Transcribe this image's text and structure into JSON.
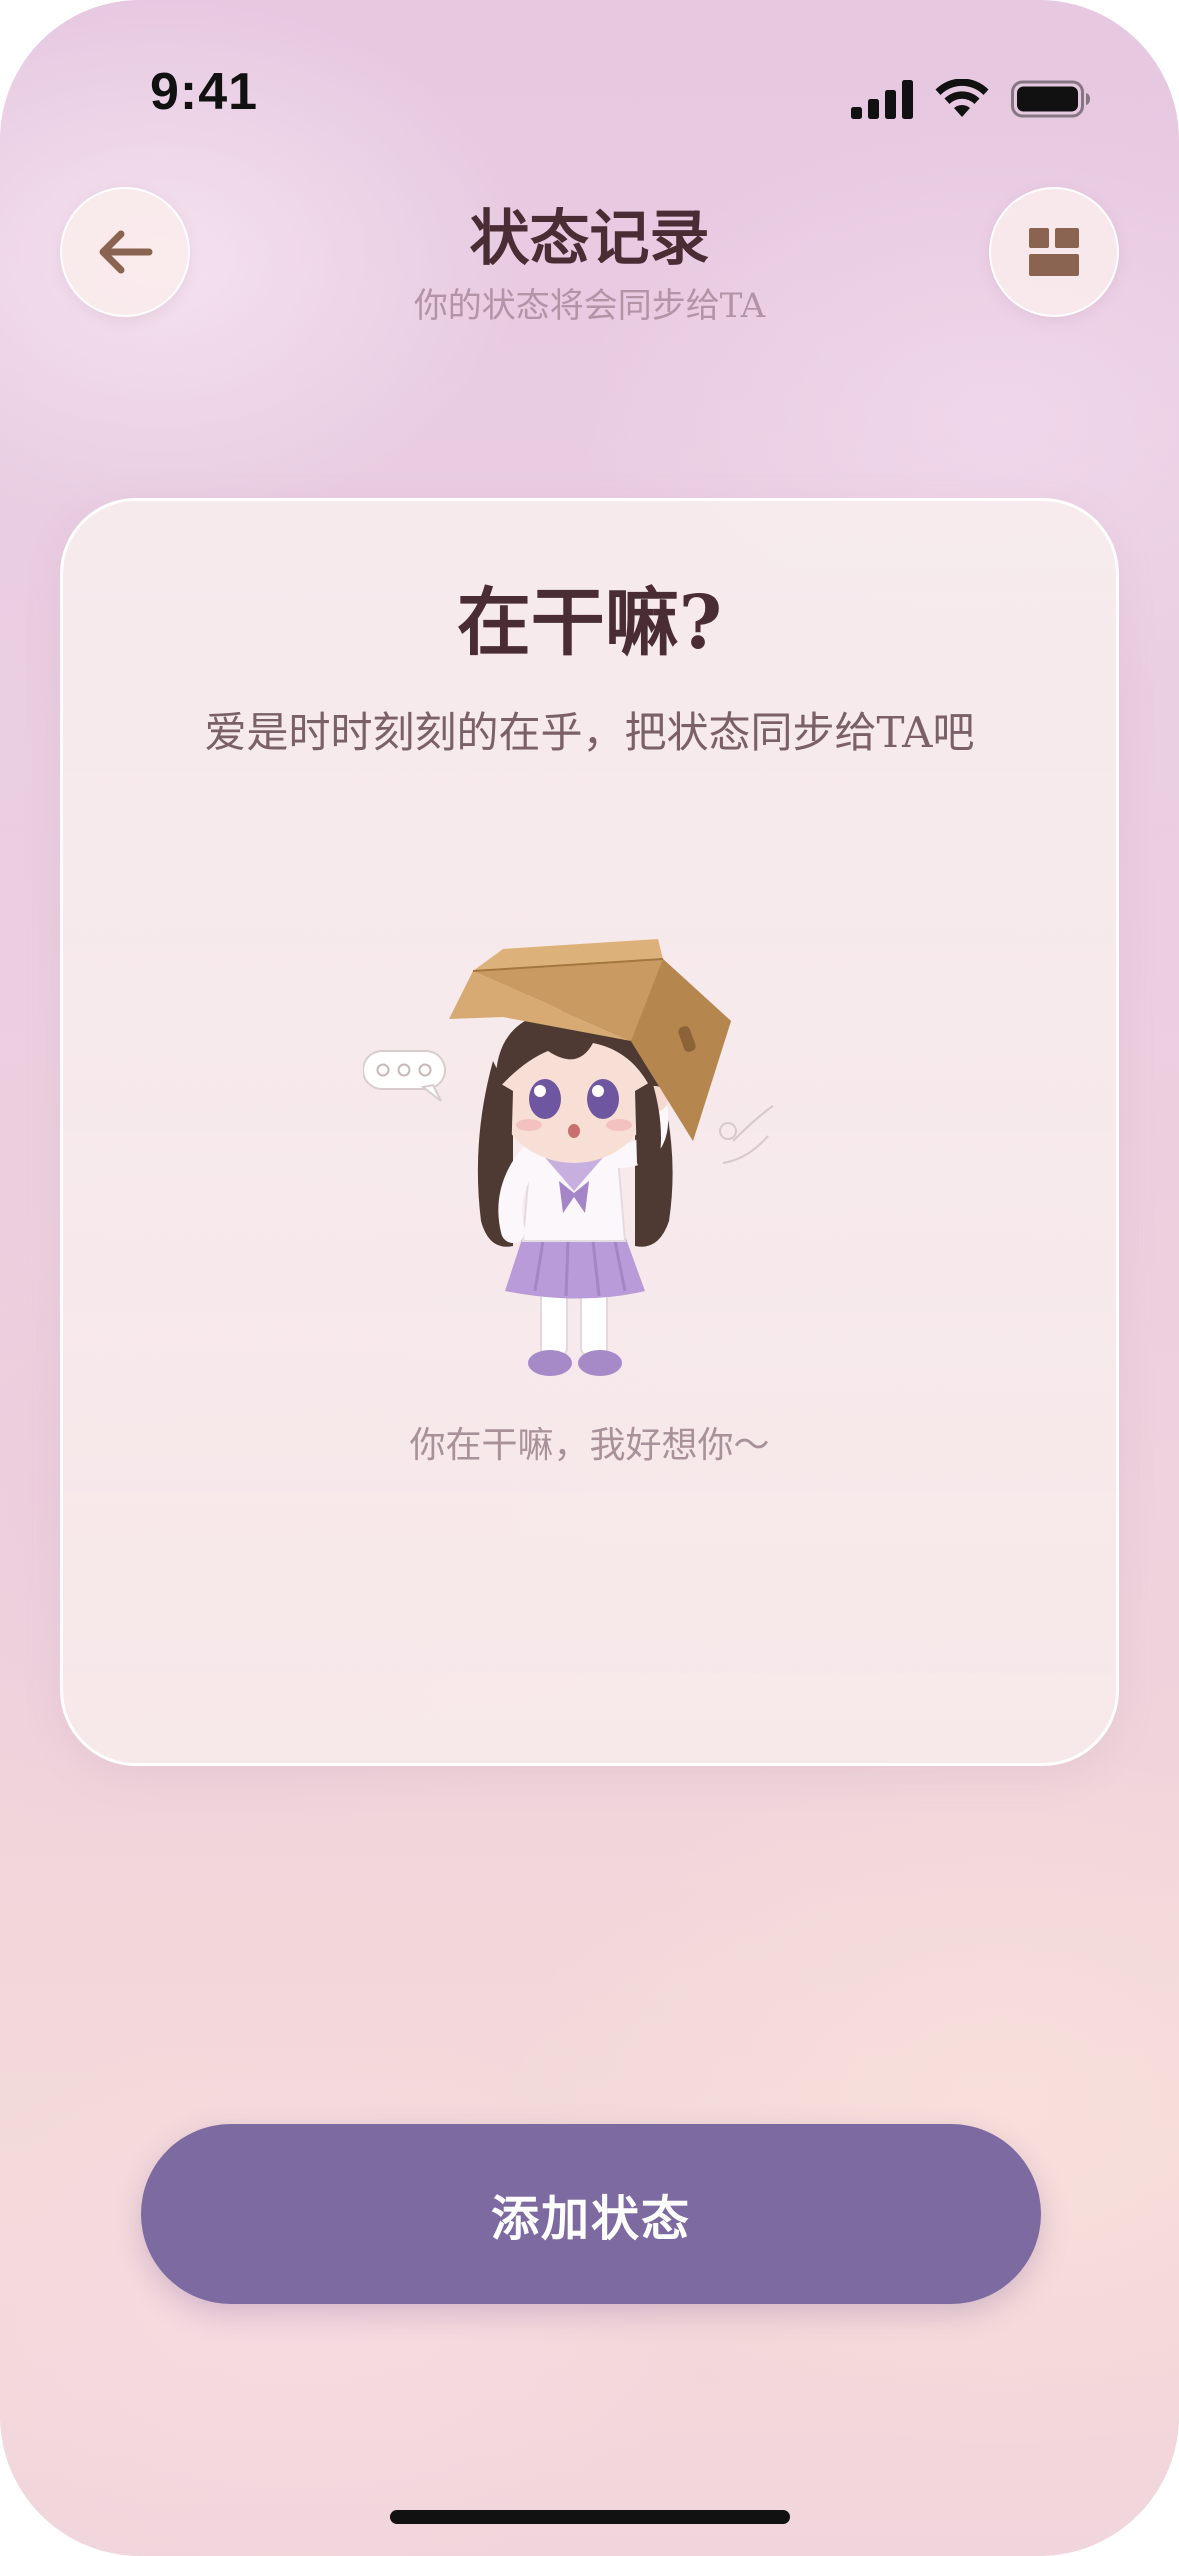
{
  "status_bar": {
    "time": "9:41",
    "icons": [
      "signal-icon",
      "wifi-icon",
      "battery-icon"
    ]
  },
  "header": {
    "title": "状态记录",
    "subtitle": "你的状态将会同步给TA",
    "back_icon": "arrow-left-icon",
    "menu_icon": "grid-icon"
  },
  "card": {
    "title": "在干嘛?",
    "subtitle": "爱是时时刻刻的在乎，把状态同步给TA吧",
    "illustration": "chibi-girl-with-box-on-head",
    "caption": "你在干嘛，我好想你～"
  },
  "actions": {
    "add_status_label": "添加状态"
  },
  "colors": {
    "accent": "#7d6aa0",
    "title_text": "#4a2c35",
    "icon_brown": "#8a6450"
  }
}
